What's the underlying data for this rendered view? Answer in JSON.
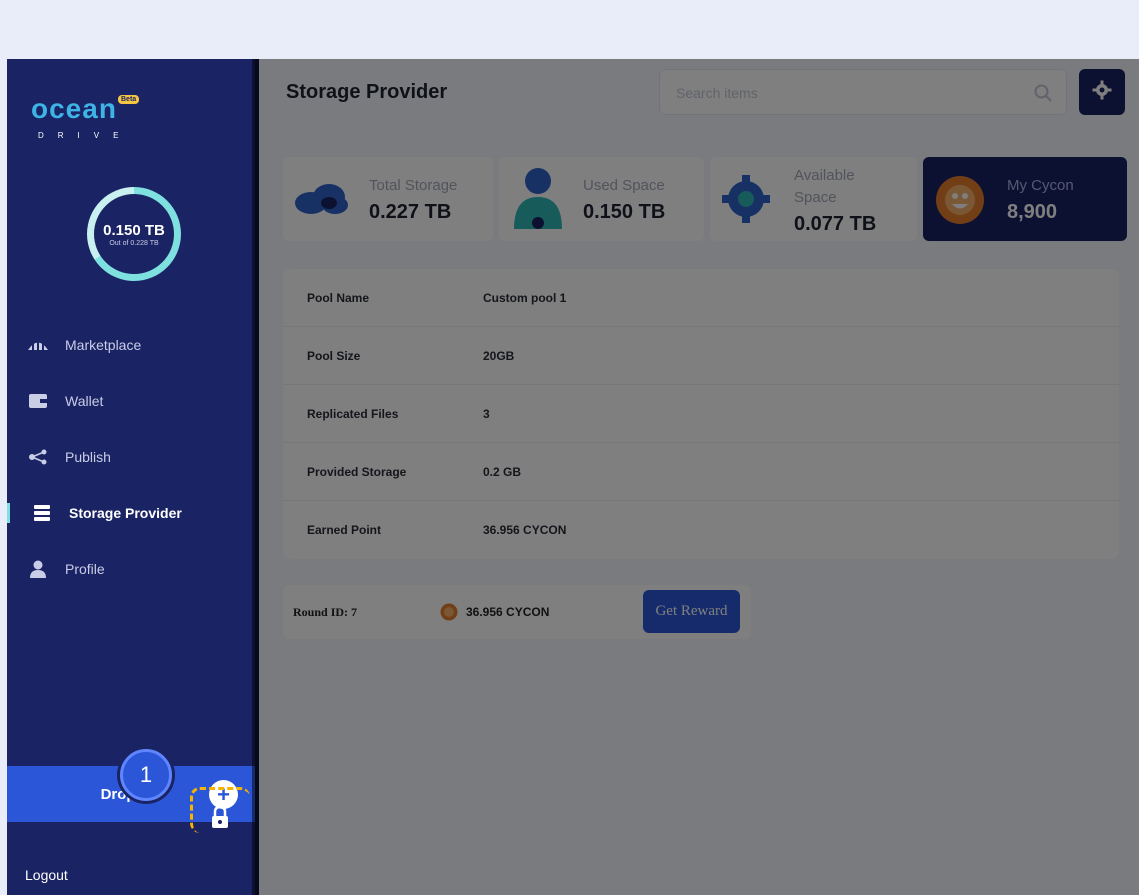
{
  "app": {
    "logo": {
      "word": "ocean",
      "badge": "Beta",
      "sub": "DRIVE"
    },
    "storage_ring": {
      "value": "0.150 TB",
      "sub": "Out of 0.228 TB",
      "fraction": 0.66
    }
  },
  "sidebar": {
    "items": [
      {
        "label": "Marketplace",
        "icon": "marketplace-icon",
        "active": false
      },
      {
        "label": "Wallet",
        "icon": "wallet-icon",
        "active": false
      },
      {
        "label": "Publish",
        "icon": "share-icon",
        "active": false
      },
      {
        "label": "Storage Provider",
        "icon": "server-icon",
        "active": true
      },
      {
        "label": "Profile",
        "icon": "user-icon",
        "active": false
      }
    ],
    "drop_file_label": "Drop file",
    "logout_label": "Logout",
    "step_badge": "1"
  },
  "header": {
    "title": "Storage Provider",
    "search_placeholder": "Search items"
  },
  "stats": [
    {
      "label": "Total Storage",
      "value": "0.227 TB"
    },
    {
      "label": "Used Space",
      "value": "0.150 TB"
    },
    {
      "label": "Available Space",
      "value": "0.077 TB"
    },
    {
      "label": "My Cycon",
      "value": "8,900"
    }
  ],
  "pool": {
    "rows": [
      {
        "key": "Pool Name",
        "value": "Custom pool 1"
      },
      {
        "key": "Pool Size",
        "value": "20GB"
      },
      {
        "key": "Replicated Files",
        "value": "3"
      },
      {
        "key": "Provided Storage",
        "value": "0.2 GB"
      },
      {
        "key": "Earned Point",
        "value": "36.956 CYCON"
      }
    ]
  },
  "reward": {
    "round_label": "Round ID: 7",
    "amount": "36.956 CYCON",
    "button_label": "Get Reward"
  },
  "colors": {
    "sidebar": "#1a2363",
    "accent": "#2b56d8",
    "ring": "#7fe0e0",
    "highlight": "#f5b400"
  }
}
